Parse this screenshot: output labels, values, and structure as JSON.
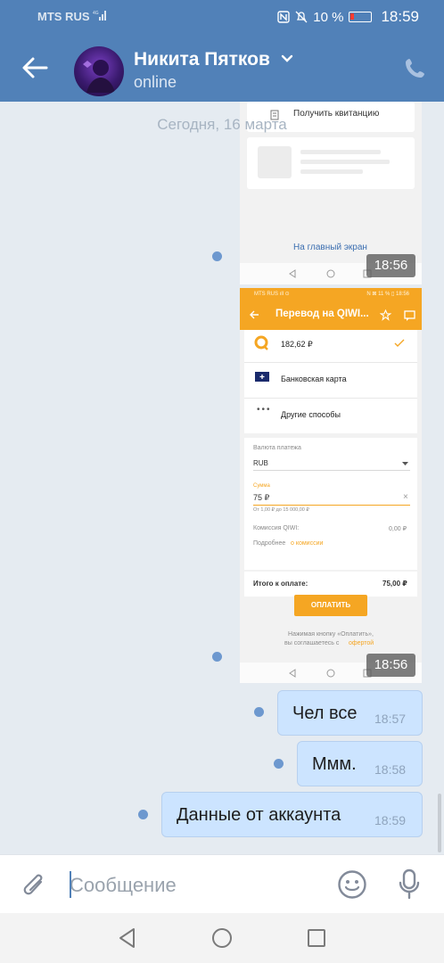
{
  "status_bar": {
    "carrier": "MTS RUS",
    "network": "4G",
    "battery": "10 %",
    "time": "18:59"
  },
  "header": {
    "contact_name": "Никита Пятков",
    "contact_status": "online"
  },
  "chat": {
    "date_separator": "Сегодня, 16 марта",
    "screenshot_1": {
      "receipt_label": "Получить квитанцию",
      "home_link": "На главный экран",
      "time": "18:56"
    },
    "screenshot_2": {
      "mini_status_left": "MTS RUS ıll ⊙",
      "mini_status_right": "N ⊠ 11 % ▯ 18:56",
      "title": "Перевод на QIWI...",
      "balance": "182,62 ₽",
      "bank_card": "Банковская карта",
      "other_methods": "Другие способы",
      "currency_label": "Валюта платежа",
      "currency_value": "RUB",
      "amount_label": "Сумма",
      "amount_value": "75 ₽",
      "amount_hint": "От 1,00 ₽ до 15 000,00 ₽",
      "commission_label": "Комиссия QIWI:",
      "commission_value": "0,00 ₽",
      "more_label": "Подробнее",
      "more_link": "о комиссии",
      "total_label": "Итого к оплате:",
      "total_value": "75,00 ₽",
      "pay_button": "ОПЛАТИТЬ",
      "footer_text_1": "Нажимая кнопку «Оплатить»,",
      "footer_text_2": "вы соглашаетесь с",
      "footer_link": "офертой",
      "time": "18:56"
    },
    "messages": [
      {
        "text": "Чел все",
        "time": "18:57"
      },
      {
        "text": "Ммм.",
        "time": "18:58"
      },
      {
        "text": "Данные от аккаунта",
        "time": "18:59"
      }
    ]
  },
  "composer": {
    "placeholder": "Сообщение"
  },
  "colors": {
    "header": "#5181b8",
    "bubble": "#cce4ff",
    "qiwi_orange": "#f5a623",
    "unread_dot": "#6d98cf"
  },
  "icons": [
    "back-arrow-icon",
    "chevron-down-icon",
    "phone-icon",
    "paperclip-icon",
    "emoji-icon",
    "microphone-icon",
    "nav-back-icon",
    "nav-home-icon",
    "nav-recent-icon"
  ]
}
